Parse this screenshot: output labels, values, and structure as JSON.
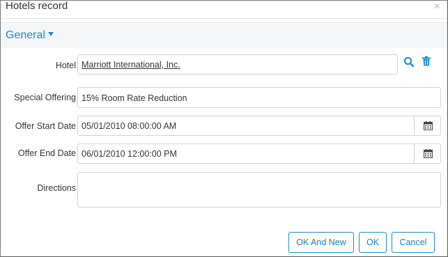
{
  "dialog": {
    "title": "Hotels record",
    "close_label": "×"
  },
  "section": {
    "title": "General"
  },
  "fields": {
    "hotel": {
      "label": "Hotel",
      "value": "Marriott International, Inc."
    },
    "special_offering": {
      "label": "Special Offering",
      "value": "15% Room Rate Reduction"
    },
    "offer_start_date": {
      "label": "Offer Start Date",
      "value": "05/01/2010 08:00:00 AM"
    },
    "offer_end_date": {
      "label": "Offer End Date",
      "value": "06/01/2010 12:00:00 PM"
    },
    "directions": {
      "label": "Directions",
      "value": ""
    }
  },
  "buttons": {
    "ok_and_new": "OK And New",
    "ok": "OK",
    "cancel": "Cancel"
  },
  "colors": {
    "accent": "#1a8ccb",
    "section_bg": "#f5f6f8",
    "border": "#cfd3d7"
  }
}
